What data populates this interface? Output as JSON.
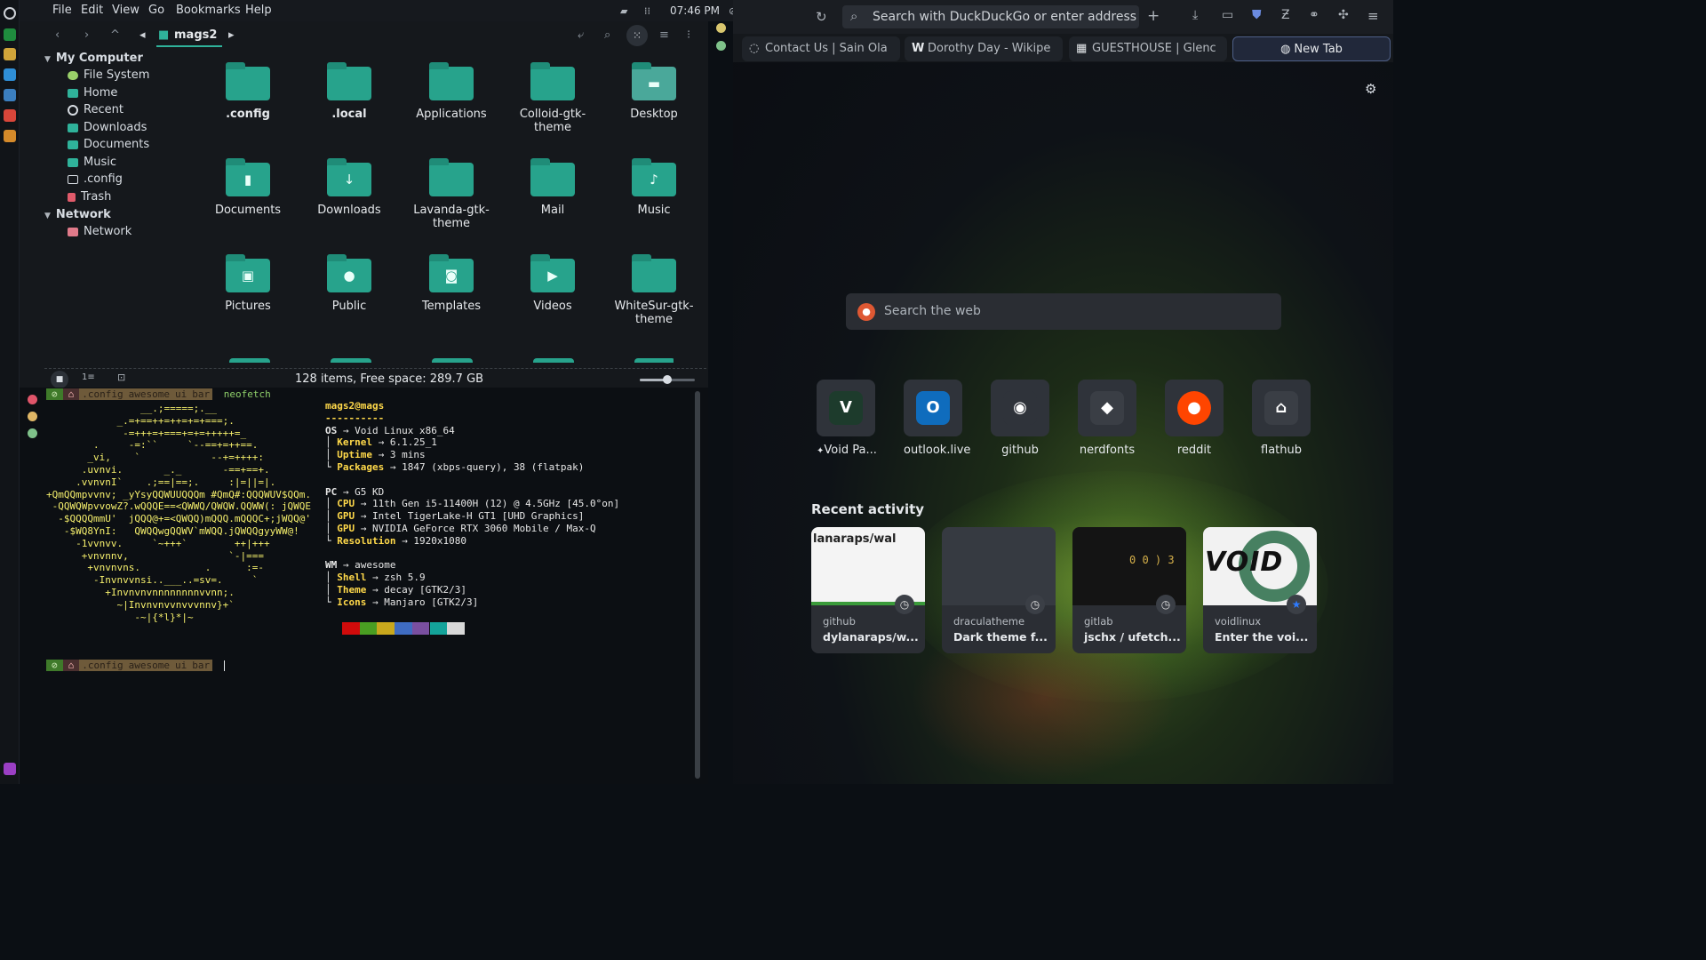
{
  "topbar": {
    "menu": [
      "File",
      "Edit",
      "View",
      "Go",
      "Bookmarks",
      "Help"
    ],
    "clock": "07:46 PM",
    "notif_count": "0"
  },
  "file_manager": {
    "path_label": "mags2",
    "sidebar": {
      "my_computer": "My Computer",
      "items": [
        "File System",
        "Home",
        "Recent",
        "Downloads",
        "Documents",
        "Music",
        ".config",
        "Trash"
      ],
      "network_head": "Network",
      "network_item": "Network"
    },
    "files": [
      {
        "name": ".config",
        "bold": true,
        "glyph": ""
      },
      {
        "name": ".local",
        "bold": true,
        "glyph": ""
      },
      {
        "name": "Applications",
        "glyph": ""
      },
      {
        "name": "Colloid-gtk-theme",
        "glyph": ""
      },
      {
        "name": "Desktop",
        "glyph": "▬"
      },
      {
        "name": "Documents",
        "glyph": "▮"
      },
      {
        "name": "Downloads",
        "glyph": "↓"
      },
      {
        "name": "Lavanda-gtk-theme",
        "glyph": ""
      },
      {
        "name": "Mail",
        "glyph": ""
      },
      {
        "name": "Music",
        "glyph": "♪"
      },
      {
        "name": "Pictures",
        "glyph": "▣"
      },
      {
        "name": "Public",
        "glyph": "●"
      },
      {
        "name": "Templates",
        "glyph": "◙"
      },
      {
        "name": "Videos",
        "glyph": "▶"
      },
      {
        "name": "WhiteSur-gtk-theme",
        "glyph": ""
      }
    ],
    "status": "128 items, Free space: 289.7 GB",
    "zoom_level": 0.5
  },
  "terminal": {
    "prompt_segments": [
      ".config",
      "awesome",
      "ui",
      "bar"
    ],
    "command": "neofetch",
    "ascii_art": [
      "                __.;=====;.__",
      "            _.=+==++=++=+=+===;.",
      "             -=+++=+===+=+=+++++=_",
      "        .     -=:``     `--==+=++==.",
      "       _vi,    `            --+=++++:",
      "      .uvnvi.       _._       -==+==+.",
      "     .vvnvnI`    .;==|==;.     :|=||=|.",
      "+QmQQmpvvnv; _yYsyQQWUUQQQm #QmQ#:QQQWUV$QQm.",
      " -QQWQWpvvowZ?.wQQQE==<QWWQ/QWQW.QQWW(: jQWQE",
      "  -$QQQQmmU'  jQQQ@+=<QWQQ)mQQQ.mQQQC+;jWQQ@'",
      "   -$WQ8YnI:   QWQQwgQQWV`mWQQ.jQWQQgyyWW@!",
      "     -1vvnvv.     `~+++`        ++|+++",
      "      +vnvnnv,                 `-|===",
      "       +vnvnvns.           .      :=-",
      "        -Invnvvnsi..___..=sv=.     `",
      "          +Invnvnvnnnnnnnnvvnn;.",
      "            ~|Invnvnvvnvvvnnv}+`",
      "               -~|{*l}*|~"
    ],
    "user_host": "mags2@mags",
    "separator": "----------",
    "os_label": "OS",
    "os_value": "Void Linux x86_64",
    "group1": [
      {
        "key": "Kernel",
        "value": "6.1.25_1"
      },
      {
        "key": "Uptime",
        "value": "3 mins"
      },
      {
        "key": "Packages",
        "value": "1847 (xbps-query), 38 (flatpak)"
      }
    ],
    "pc_label": "PC",
    "pc_value": "G5 KD",
    "group2": [
      {
        "key": "CPU",
        "value": "11th Gen i5-11400H (12) @ 4.5GHz [45.0°on]"
      },
      {
        "key": "GPU",
        "value": "Intel TigerLake-H GT1 [UHD Graphics]"
      },
      {
        "key": "GPU",
        "value": "NVIDIA GeForce RTX 3060 Mobile / Max-Q"
      },
      {
        "key": "Resolution",
        "value": "1920x1080"
      }
    ],
    "wm_label": "WM",
    "wm_value": "awesome",
    "group3": [
      {
        "key": "Shell",
        "value": "zsh 5.9"
      },
      {
        "key": "Theme",
        "value": "decay [GTK2/3]"
      },
      {
        "key": "Icons",
        "value": "Manjaro [GTK2/3]"
      }
    ],
    "palette": [
      "#d10b0b",
      "#4a9e22",
      "#c9a81d",
      "#3f6cc2",
      "#7a4fa0",
      "#14a39a",
      "#d8d8d8"
    ]
  },
  "browser": {
    "urlbar_placeholder": "Search with DuckDuckGo or enter address",
    "tabs": [
      {
        "label": "Contact Us | Sain Ola",
        "icon": "◌"
      },
      {
        "label": "Dorothy Day - Wikipe",
        "icon": "W"
      },
      {
        "label": "GUESTHOUSE | Glenc",
        "icon": "▦"
      },
      {
        "label": "New Tab",
        "icon": "◍"
      }
    ],
    "search_placeholder": "Search the web",
    "shortcuts": [
      {
        "label": "Void Pa...",
        "icon": "V",
        "color": "#1d3b2c",
        "pinned": true
      },
      {
        "label": "outlook.live",
        "icon": "O",
        "color": "#0f6cbd"
      },
      {
        "label": "github",
        "icon": "◉",
        "color": "#2f333a"
      },
      {
        "label": "nerdfonts",
        "icon": "◆",
        "color": "#3a3e45"
      },
      {
        "label": "reddit",
        "icon": "●",
        "color": "#ff4500"
      },
      {
        "label": "flathub",
        "icon": "⌂",
        "color": "#3a3e45"
      }
    ],
    "recent_heading": "Recent activity",
    "recent": [
      {
        "source": "github",
        "title": "dylanaraps/w...",
        "thumb_text": "lanaraps/wal"
      },
      {
        "source": "draculatheme",
        "title": "Dark theme f...",
        "thumb_text": ""
      },
      {
        "source": "gitlab",
        "title": "jschx / ufetch...",
        "thumb_text": "0 0 ) 3"
      },
      {
        "source": "voidlinux",
        "title": "Enter the voi...",
        "thumb_text": "VOID"
      }
    ]
  }
}
